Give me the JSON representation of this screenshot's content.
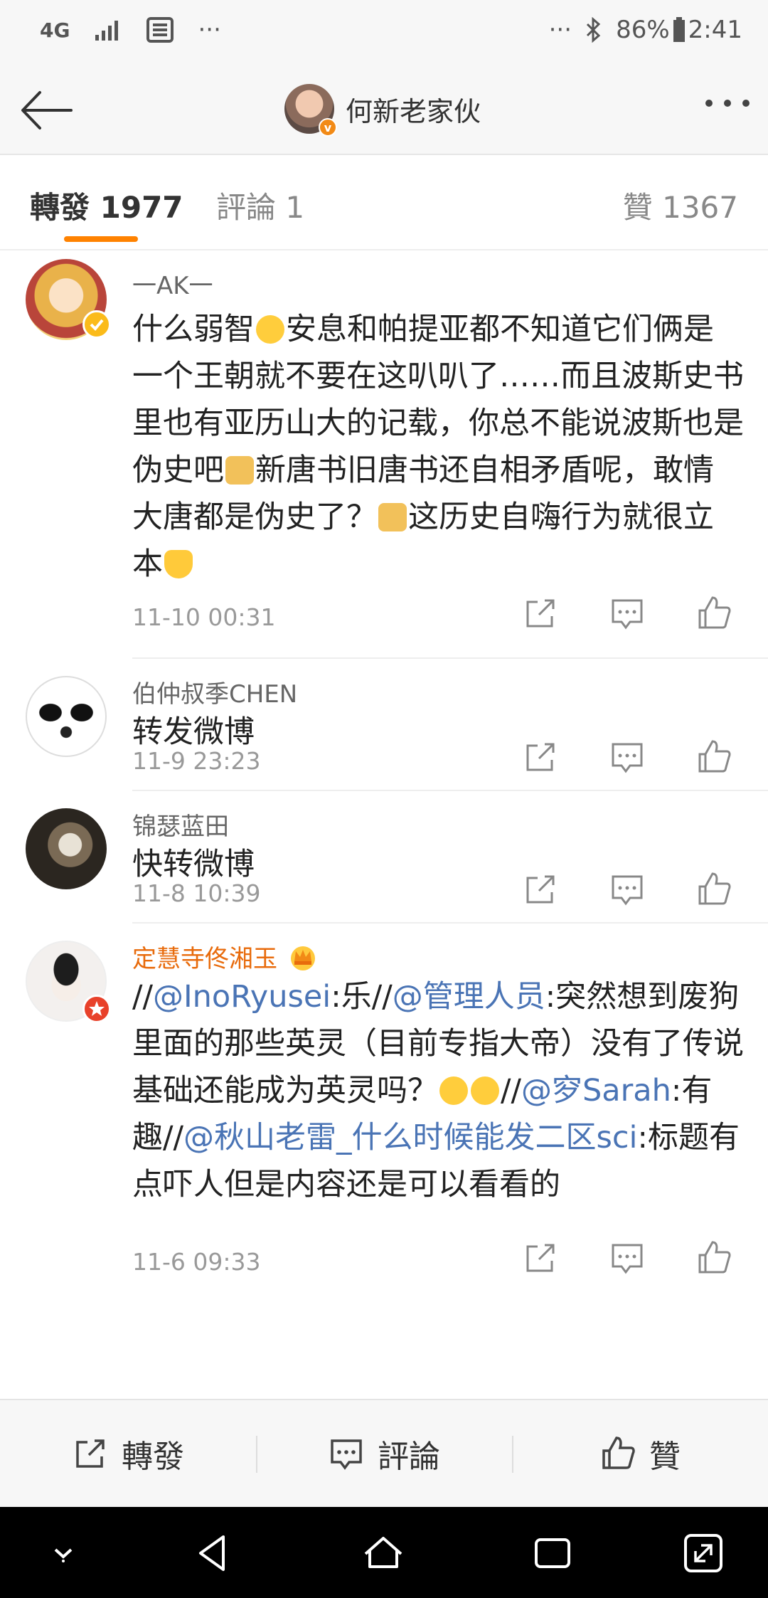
{
  "status_bar": {
    "network": "4G",
    "ellipsis_left": "···",
    "ellipsis_right": "···",
    "battery": "86%",
    "time": "2:41"
  },
  "nav": {
    "title": "何新老家伙"
  },
  "tabs": [
    {
      "label": "轉發 1977",
      "active": true
    },
    {
      "label": "評論 1",
      "active": false
    },
    {
      "label": "贊 1367",
      "active": false
    }
  ],
  "posts": [
    {
      "name": "一AK一",
      "lines": [
        {
          "text": "什么弱智",
          "emoji_after": "laugh-cry"
        },
        {
          "text": "安息和帕提亚都不知道它们俩是"
        },
        {
          "text": "一个王朝就不要在这叭叭了……而且波斯史"
        },
        {
          "text": "书里也有亚历山大的记载，你总不能说波斯"
        }
      ],
      "content_part1": "什么弱智",
      "content_part2": "安息和帕提亚都不知道它们俩是一个王朝就不要在这叭叭了……而且波斯史书里也有亚历山大的记载，你总不能说波斯也是伪史吧",
      "content_part3": "新唐书旧唐书还自相矛盾呢，敢情大唐都是伪史了？",
      "content_part4": "这历史自嗨行为就很立本",
      "time": "11-10 00:31"
    },
    {
      "name": "伯仲叔季CHEN",
      "content": "转发微博",
      "time": "11-9 23:23"
    },
    {
      "name": "锦瑟蓝田",
      "content": "快转微博",
      "time": "11-8 10:39"
    },
    {
      "name": "定慧寺佟湘玉",
      "seg1": "//",
      "link1": "@InoRyusei",
      "seg2": ":乐//",
      "link2": "@管理人员",
      "seg3": ":突然想到废狗里面的那些英灵（目前专指大帝）没有了传说基础还能成为英灵吗？",
      "seg4": "//",
      "link3": "@穸Sarah",
      "seg5": ":有趣//",
      "link4": "@秋山老雷_什么时候能发二区sci",
      "seg6": ":标题有点吓人但是内容还是可以看看的",
      "time": "11-6 09:33"
    }
  ],
  "toolbar": {
    "repost": "轉發",
    "comment": "評論",
    "like": "贊"
  },
  "colors": {
    "accent": "#ff8200",
    "link": "#4a74b5",
    "vip_name": "#e86b0c"
  }
}
